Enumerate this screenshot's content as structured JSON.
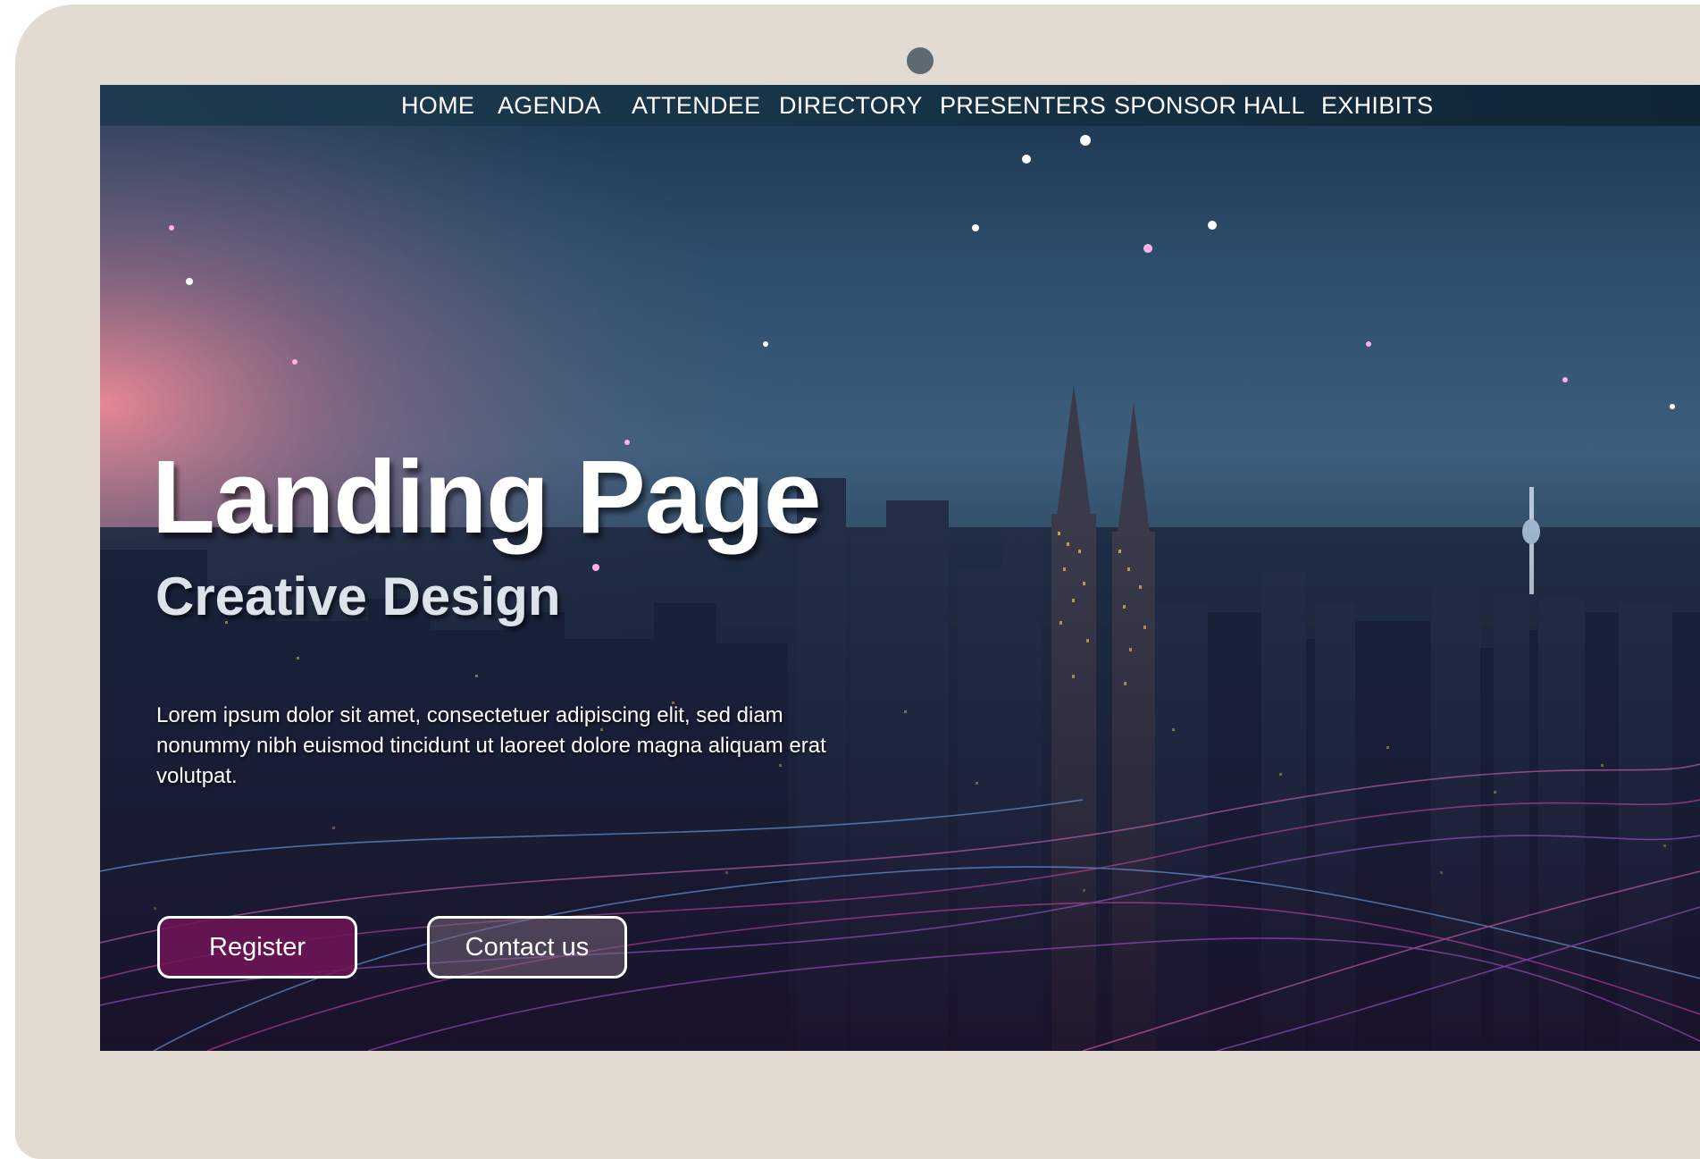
{
  "nav": {
    "items": [
      {
        "label": "HOME"
      },
      {
        "label": "AGENDA"
      },
      {
        "label": "ATTENDEE"
      },
      {
        "label": "DIRECTORY"
      },
      {
        "label": "PRESENTERS"
      },
      {
        "label": "SPONSOR HALL"
      },
      {
        "label": "EXHIBITS"
      }
    ]
  },
  "hero": {
    "title": "Landing Page",
    "subtitle": "Creative Design",
    "paragraph": "Lorem ipsum dolor sit amet, consectetuer adipiscing elit, sed diam nonummy nibh euismod tincidunt ut laoreet dolore magna aliquam erat volutpat.",
    "background": "night-city-skyline-with-light-beams"
  },
  "buttons": {
    "register": "Register",
    "contact": "Contact us"
  },
  "colors": {
    "frame": "#e3dbd1",
    "navbar": "#1e3a4f",
    "register_button": "#6e1456",
    "accent_pink": "#d84ab0",
    "accent_blue": "#7fb4ff"
  }
}
